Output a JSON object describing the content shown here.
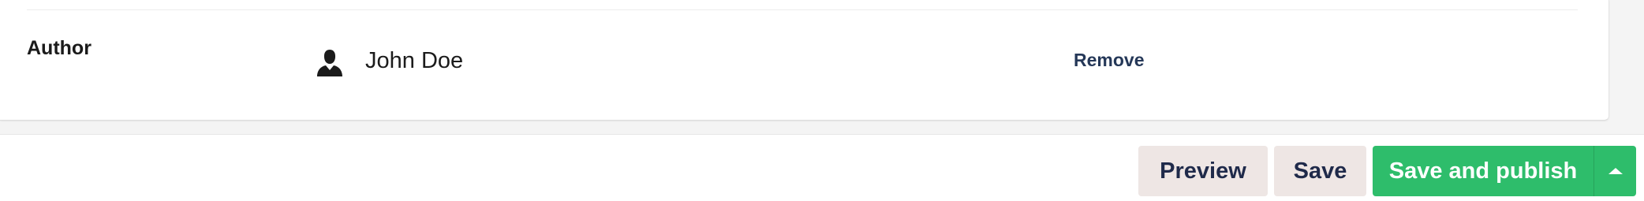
{
  "property": {
    "label": "Author"
  },
  "author": {
    "icon": "user-icon",
    "name": "John Doe",
    "remove_label": "Remove"
  },
  "footer": {
    "preview_label": "Preview",
    "save_label": "Save",
    "publish_label": "Save and publish",
    "more_actions_icon": "caret-up-icon"
  },
  "colors": {
    "primary": "#2ebd6b",
    "secondary_bg": "#eee6e4",
    "link": "#253858"
  }
}
